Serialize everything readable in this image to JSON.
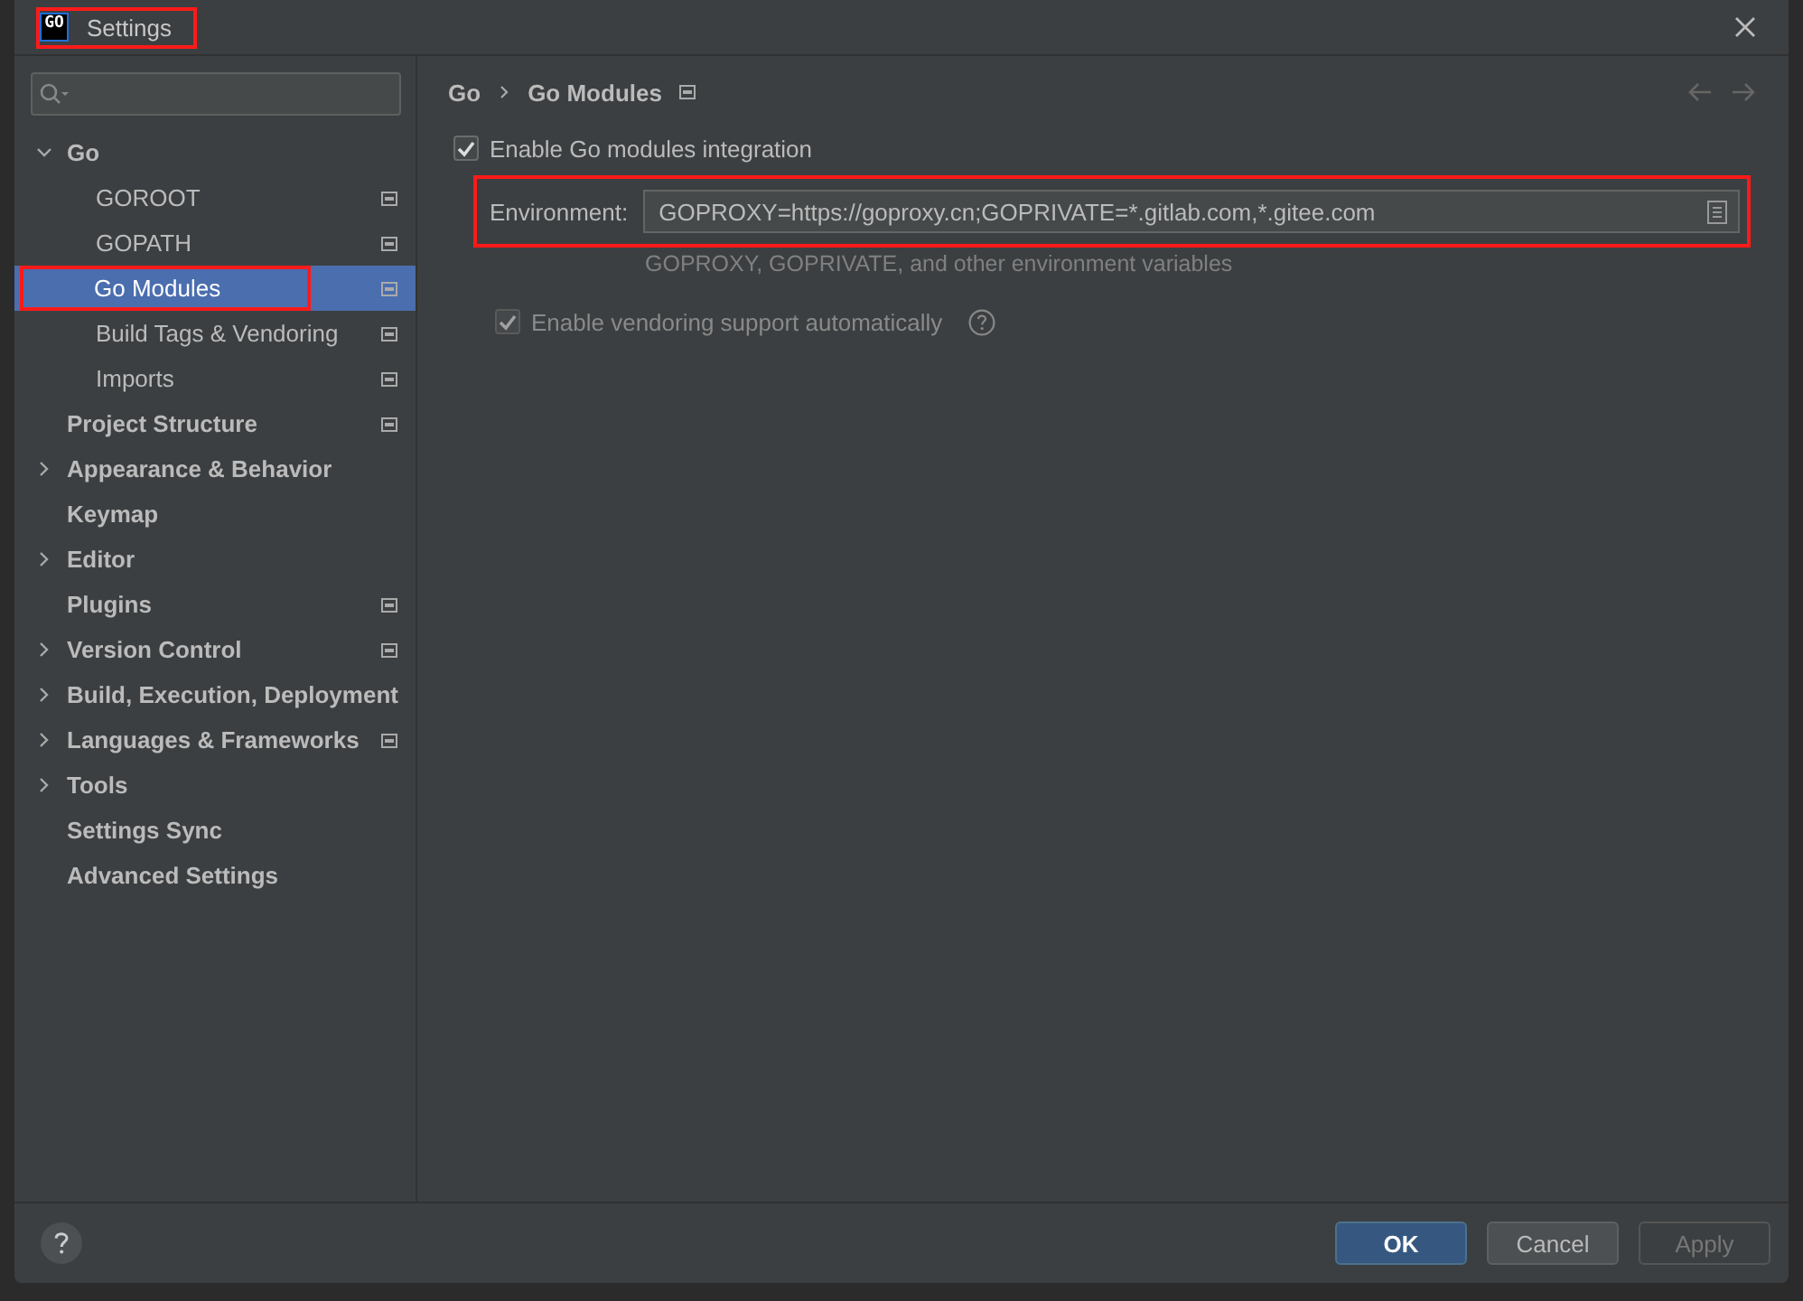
{
  "window": {
    "icon_text": "GO",
    "title": "Settings",
    "highlighted": true
  },
  "tree": [
    {
      "label": "Go",
      "expanded": true,
      "selected": false,
      "highlighted": false,
      "project_scoped": false,
      "children": [
        {
          "label": "GOROOT",
          "selected": false,
          "highlighted": false,
          "project_scoped": true
        },
        {
          "label": "GOPATH",
          "selected": false,
          "highlighted": false,
          "project_scoped": true
        },
        {
          "label": "Go Modules",
          "selected": true,
          "highlighted": true,
          "project_scoped": true
        },
        {
          "label": "Build Tags & Vendoring",
          "selected": false,
          "highlighted": false,
          "project_scoped": true
        },
        {
          "label": "Imports",
          "selected": false,
          "highlighted": false,
          "project_scoped": true
        }
      ]
    },
    {
      "label": "Project Structure",
      "selected": false,
      "highlighted": false,
      "project_scoped": true
    },
    {
      "label": "Appearance & Behavior",
      "expanded": false,
      "selected": false,
      "highlighted": false,
      "project_scoped": false
    },
    {
      "label": "Keymap",
      "selected": false,
      "highlighted": false,
      "project_scoped": false
    },
    {
      "label": "Editor",
      "expanded": false,
      "selected": false,
      "highlighted": false,
      "project_scoped": false
    },
    {
      "label": "Plugins",
      "selected": false,
      "highlighted": false,
      "project_scoped": true
    },
    {
      "label": "Version Control",
      "expanded": false,
      "selected": false,
      "highlighted": false,
      "project_scoped": true
    },
    {
      "label": "Build, Execution, Deployment",
      "expanded": false,
      "selected": false,
      "highlighted": false,
      "project_scoped": false
    },
    {
      "label": "Languages & Frameworks",
      "expanded": false,
      "selected": false,
      "highlighted": false,
      "project_scoped": true
    },
    {
      "label": "Tools",
      "expanded": false,
      "selected": false,
      "highlighted": false,
      "project_scoped": false
    },
    {
      "label": "Settings Sync",
      "selected": false,
      "highlighted": false,
      "project_scoped": false
    },
    {
      "label": "Advanced Settings",
      "selected": false,
      "highlighted": false,
      "project_scoped": false
    }
  ],
  "breadcrumb": {
    "items": [
      "Go",
      "Go Modules"
    ],
    "project_scoped": true
  },
  "options": [
    {
      "kind": "checkbox",
      "label": "Enable Go modules integration",
      "checked": true,
      "disabled": false,
      "help": false
    },
    {
      "kind": "field",
      "label": "Environment:",
      "value": "GOPROXY=https://goproxy.cn;GOPRIVATE=*.gitlab.com,*.gitee.com",
      "highlighted": true
    },
    {
      "kind": "hint",
      "text": "GOPROXY, GOPRIVATE, and other environment variables"
    },
    {
      "kind": "checkbox",
      "label": "Enable vendoring support automatically",
      "checked": true,
      "disabled": true,
      "help": true
    }
  ],
  "buttons": [
    {
      "label": "OK",
      "primary": true,
      "disabled": false
    },
    {
      "label": "Cancel",
      "primary": false,
      "disabled": false
    },
    {
      "label": "Apply",
      "primary": false,
      "disabled": true
    }
  ]
}
